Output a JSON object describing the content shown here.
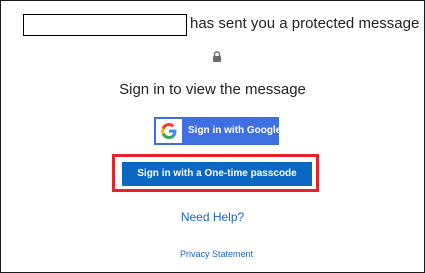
{
  "message_header": {
    "sender_suffix": "has sent you a protected message"
  },
  "lock": {
    "icon": "lock-icon"
  },
  "signin": {
    "heading": "Sign in to view the message",
    "google_button_label": "Sign in with Google",
    "otp_button_label": "Sign in with a One-time passcode"
  },
  "links": {
    "need_help": "Need Help?",
    "privacy_statement": "Privacy Statement"
  },
  "colors": {
    "google_button": "#3f6fe0",
    "otp_button": "#0a67c4",
    "highlight_frame": "#e8212b",
    "link": "#1a63c9"
  }
}
